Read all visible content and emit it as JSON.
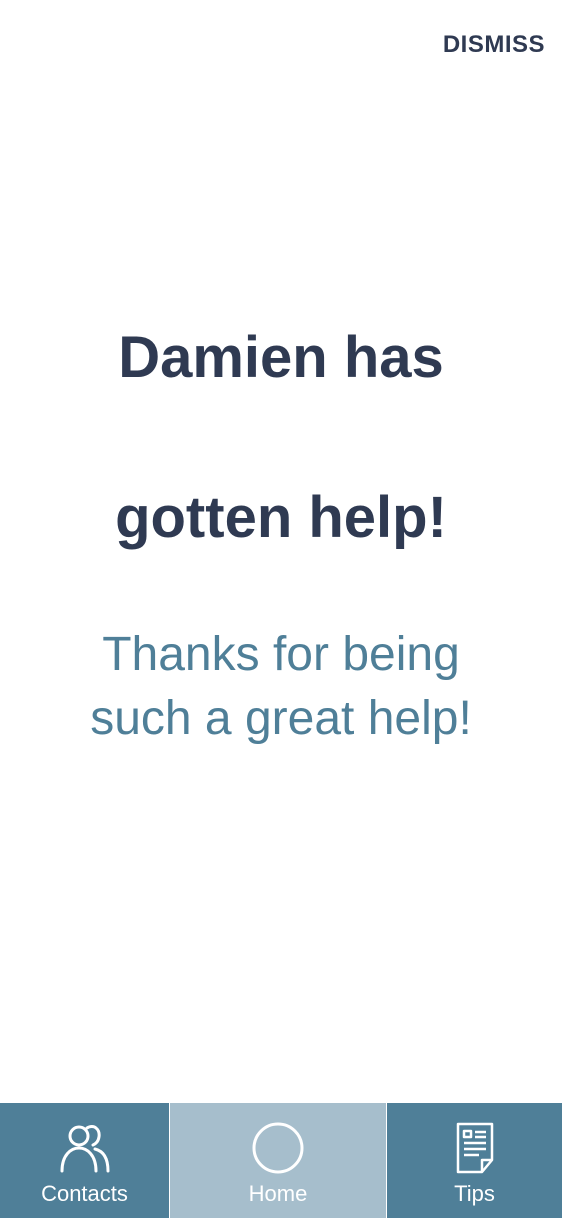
{
  "header": {
    "dismiss_label": "DISMISS"
  },
  "main": {
    "headline_line1": "Damien has",
    "headline_line2": "gotten help!",
    "message_line1": "Thanks for being",
    "message_line2": "such a great help!"
  },
  "tabbar": {
    "tabs": [
      {
        "label": "Contacts",
        "icon": "contacts-icon",
        "active": false
      },
      {
        "label": "Home",
        "icon": "home-circle-icon",
        "active": true
      },
      {
        "label": "Tips",
        "icon": "tips-document-icon",
        "active": false
      }
    ]
  },
  "colors": {
    "heading": "#2f3a52",
    "message": "#4f7f98",
    "tab_bg": "#4f7f98",
    "tab_active_bg": "#a6becc"
  }
}
